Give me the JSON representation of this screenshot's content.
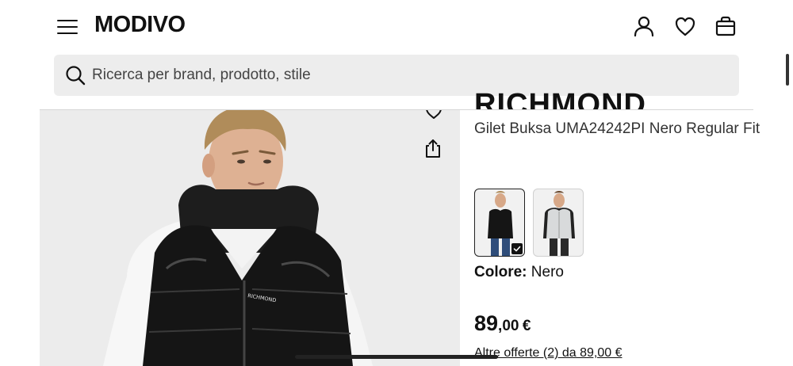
{
  "header": {
    "logo": "MODIVO"
  },
  "search": {
    "placeholder": "Ricerca per brand, prodotto, stile"
  },
  "product": {
    "name": "Gilet Buksa UMA24242PI Nero Regular Fit",
    "color_label": "Colore:",
    "color_value": "Nero",
    "price_main": "89",
    "price_decimals": ",00",
    "price_currency": "€",
    "offers_text": "Altre offerte (2) da 89,00 €"
  },
  "swatches": [
    {
      "color": "#1b1b1b",
      "selected": true
    },
    {
      "color": "#d8dadb",
      "selected": false
    }
  ],
  "colors": {
    "background": "#ffffff",
    "search_bg": "#ededed",
    "gallery_bg": "#ececec",
    "text": "#111111"
  },
  "icons": [
    "menu-icon",
    "user-icon",
    "heart-icon",
    "bag-icon",
    "search-icon",
    "share-icon",
    "check-icon"
  ]
}
